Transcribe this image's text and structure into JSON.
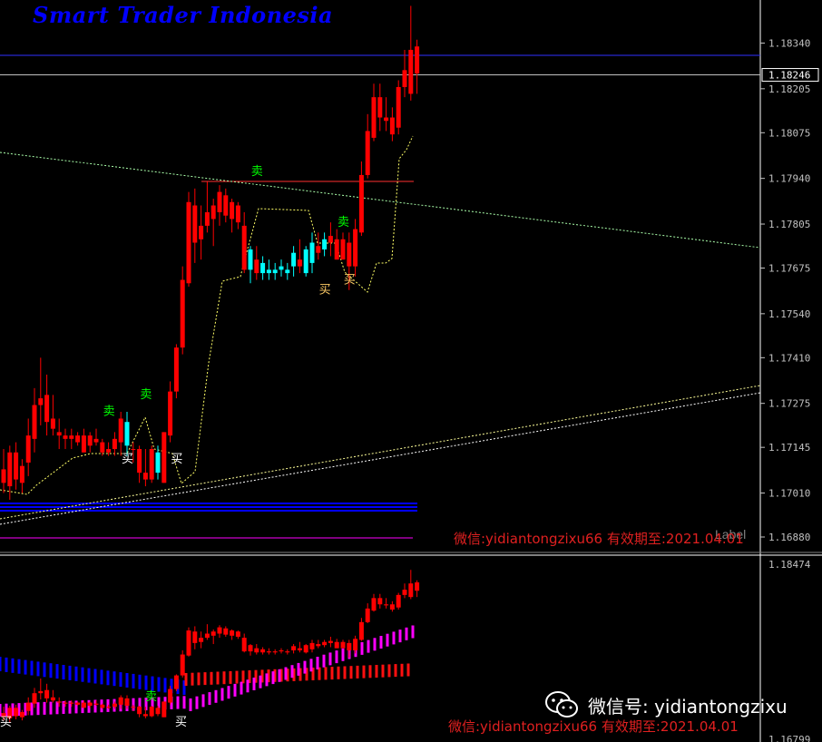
{
  "brand_title": "Smart Trader Indonesia",
  "watermark_top": "微信:yidiantongzixu66 有效期至:2021.04.01",
  "watermark_bottom": "微信:yidiantongzixu66  有效期至:2021.04.01",
  "label_text": "Label",
  "wechat_id": "微信号: yidiantongzixu",
  "colors": {
    "bull": "#00ffff",
    "bear": "#ff0000",
    "blue_band": "#0000ff",
    "magenta_band": "#ff00ff",
    "axis_text": "#c0c0c0",
    "grid_border": "#ffffff"
  },
  "chart_data": [
    {
      "type": "candlestick",
      "pane": "main",
      "ylim": [
        1.168,
        1.1847
      ],
      "y_ticks": [
        "1.18470",
        "1.18340",
        "1.18205",
        "1.18075",
        "1.17940",
        "1.17805",
        "1.17675",
        "1.17540",
        "1.17410",
        "1.17275",
        "1.17145",
        "1.17010",
        "1.16880"
      ],
      "current_price": "1.18246",
      "candles": [
        {
          "o": 1.1708,
          "h": 1.1714,
          "l": 1.1701,
          "c": 1.1704
        },
        {
          "o": 1.1703,
          "h": 1.1715,
          "l": 1.1699,
          "c": 1.1713
        },
        {
          "o": 1.1713,
          "h": 1.1716,
          "l": 1.1702,
          "c": 1.1705
        },
        {
          "o": 1.1704,
          "h": 1.1711,
          "l": 1.1701,
          "c": 1.1709
        },
        {
          "o": 1.171,
          "h": 1.1723,
          "l": 1.1706,
          "c": 1.1718
        },
        {
          "o": 1.1717,
          "h": 1.1732,
          "l": 1.1713,
          "c": 1.1727
        },
        {
          "o": 1.1727,
          "h": 1.1741,
          "l": 1.1721,
          "c": 1.1729
        },
        {
          "o": 1.173,
          "h": 1.1736,
          "l": 1.1718,
          "c": 1.1722
        },
        {
          "o": 1.1723,
          "h": 1.173,
          "l": 1.1718,
          "c": 1.172
        },
        {
          "o": 1.1719,
          "h": 1.1723,
          "l": 1.1714,
          "c": 1.1718
        },
        {
          "o": 1.1718,
          "h": 1.172,
          "l": 1.1714,
          "c": 1.1717
        },
        {
          "o": 1.1718,
          "h": 1.172,
          "l": 1.1714,
          "c": 1.1717
        },
        {
          "o": 1.1718,
          "h": 1.1719,
          "l": 1.1715,
          "c": 1.1716
        },
        {
          "o": 1.1713,
          "h": 1.172,
          "l": 1.1713,
          "c": 1.1718
        },
        {
          "o": 1.1715,
          "h": 1.1719,
          "l": 1.1713,
          "c": 1.1718
        },
        {
          "o": 1.1716,
          "h": 1.172,
          "l": 1.1715,
          "c": 1.1717
        },
        {
          "o": 1.1713,
          "h": 1.1717,
          "l": 1.1712,
          "c": 1.1716
        },
        {
          "o": 1.1713,
          "h": 1.1716,
          "l": 1.1712,
          "c": 1.1714
        },
        {
          "o": 1.1714,
          "h": 1.1719,
          "l": 1.1712,
          "c": 1.1717
        },
        {
          "o": 1.1716,
          "h": 1.1725,
          "l": 1.1712,
          "c": 1.1723
        },
        {
          "o": 1.1722,
          "h": 1.1725,
          "l": 1.1712,
          "c": 1.1715
        },
        {
          "o": 1.1714,
          "h": 1.1716,
          "l": 1.171,
          "c": 1.1714
        },
        {
          "o": 1.1707,
          "h": 1.1715,
          "l": 1.1704,
          "c": 1.1714
        },
        {
          "o": 1.1705,
          "h": 1.1714,
          "l": 1.1703,
          "c": 1.1707
        },
        {
          "o": 1.1705,
          "h": 1.1715,
          "l": 1.1704,
          "c": 1.1714
        },
        {
          "o": 1.1713,
          "h": 1.1715,
          "l": 1.1705,
          "c": 1.1707
        },
        {
          "o": 1.1704,
          "h": 1.1719,
          "l": 1.1704,
          "c": 1.1719
        },
        {
          "o": 1.1718,
          "h": 1.1734,
          "l": 1.1716,
          "c": 1.1731
        },
        {
          "o": 1.1731,
          "h": 1.1745,
          "l": 1.1729,
          "c": 1.1744
        },
        {
          "o": 1.1744,
          "h": 1.1768,
          "l": 1.1742,
          "c": 1.1764
        },
        {
          "o": 1.1763,
          "h": 1.179,
          "l": 1.1762,
          "c": 1.1787
        },
        {
          "o": 1.1786,
          "h": 1.1791,
          "l": 1.1769,
          "c": 1.1775
        },
        {
          "o": 1.1776,
          "h": 1.1786,
          "l": 1.177,
          "c": 1.178
        },
        {
          "o": 1.178,
          "h": 1.1793,
          "l": 1.1778,
          "c": 1.1784
        },
        {
          "o": 1.1782,
          "h": 1.1788,
          "l": 1.1774,
          "c": 1.1786
        },
        {
          "o": 1.1784,
          "h": 1.1792,
          "l": 1.178,
          "c": 1.179
        },
        {
          "o": 1.1789,
          "h": 1.1791,
          "l": 1.1781,
          "c": 1.1783
        },
        {
          "o": 1.1782,
          "h": 1.1788,
          "l": 1.1778,
          "c": 1.1787
        },
        {
          "o": 1.1786,
          "h": 1.1787,
          "l": 1.1779,
          "c": 1.1781
        },
        {
          "o": 1.178,
          "h": 1.1784,
          "l": 1.1766,
          "c": 1.1767
        },
        {
          "o": 1.1767,
          "h": 1.1774,
          "l": 1.1763,
          "c": 1.1773
        },
        {
          "o": 1.177,
          "h": 1.1774,
          "l": 1.1764,
          "c": 1.1766
        },
        {
          "o": 1.1766,
          "h": 1.1771,
          "l": 1.1764,
          "c": 1.1769
        },
        {
          "o": 1.1766,
          "h": 1.177,
          "l": 1.1764,
          "c": 1.1767
        },
        {
          "o": 1.1766,
          "h": 1.1769,
          "l": 1.1764,
          "c": 1.1767
        },
        {
          "o": 1.1767,
          "h": 1.177,
          "l": 1.1765,
          "c": 1.1768
        },
        {
          "o": 1.1766,
          "h": 1.1769,
          "l": 1.1764,
          "c": 1.1767
        },
        {
          "o": 1.1768,
          "h": 1.1774,
          "l": 1.1765,
          "c": 1.1772
        },
        {
          "o": 1.177,
          "h": 1.1776,
          "l": 1.1766,
          "c": 1.1768
        },
        {
          "o": 1.1766,
          "h": 1.1774,
          "l": 1.1765,
          "c": 1.1773
        },
        {
          "o": 1.1769,
          "h": 1.1778,
          "l": 1.1766,
          "c": 1.1775
        },
        {
          "o": 1.1774,
          "h": 1.1778,
          "l": 1.177,
          "c": 1.1772
        },
        {
          "o": 1.1773,
          "h": 1.1778,
          "l": 1.1771,
          "c": 1.1776
        },
        {
          "o": 1.1777,
          "h": 1.1781,
          "l": 1.1771,
          "c": 1.1775
        },
        {
          "o": 1.1776,
          "h": 1.1779,
          "l": 1.177,
          "c": 1.177
        },
        {
          "o": 1.1776,
          "h": 1.1778,
          "l": 1.177,
          "c": 1.177
        },
        {
          "o": 1.1775,
          "h": 1.1778,
          "l": 1.1761,
          "c": 1.1768
        },
        {
          "o": 1.1768,
          "h": 1.1782,
          "l": 1.1765,
          "c": 1.1779
        },
        {
          "o": 1.1778,
          "h": 1.1799,
          "l": 1.1777,
          "c": 1.1795
        },
        {
          "o": 1.1795,
          "h": 1.1813,
          "l": 1.1794,
          "c": 1.1808
        },
        {
          "o": 1.1806,
          "h": 1.1822,
          "l": 1.1805,
          "c": 1.1818
        },
        {
          "o": 1.1818,
          "h": 1.1822,
          "l": 1.1808,
          "c": 1.1812
        },
        {
          "o": 1.1811,
          "h": 1.1818,
          "l": 1.1808,
          "c": 1.1812
        },
        {
          "o": 1.1807,
          "h": 1.1815,
          "l": 1.1805,
          "c": 1.1812
        },
        {
          "o": 1.1809,
          "h": 1.1823,
          "l": 1.1807,
          "c": 1.1821
        },
        {
          "o": 1.1821,
          "h": 1.1832,
          "l": 1.1818,
          "c": 1.1826
        },
        {
          "o": 1.1819,
          "h": 1.1845,
          "l": 1.1817,
          "c": 1.1832
        },
        {
          "o": 1.1833,
          "h": 1.1835,
          "l": 1.1819,
          "c": 1.1825
        }
      ],
      "signals": [
        {
          "text": "卖",
          "i": 17,
          "price": 1.1724,
          "color": "#00ff00"
        },
        {
          "text": "买",
          "i": 20,
          "price": 1.171,
          "color": "#ffffff"
        },
        {
          "text": "卖",
          "i": 23,
          "price": 1.1729,
          "color": "#00ff00"
        },
        {
          "text": "买",
          "i": 28,
          "price": 1.171,
          "color": "#ffffff"
        },
        {
          "text": "卖",
          "i": 41,
          "price": 1.1795,
          "color": "#00ff00"
        },
        {
          "text": "买",
          "i": 52,
          "price": 1.176,
          "color": "#ffcc66"
        },
        {
          "text": "卖",
          "i": 55,
          "price": 1.178,
          "color": "#00ff00"
        },
        {
          "text": "买",
          "i": 56,
          "price": 1.1763,
          "color": "#ffcc66"
        }
      ]
    },
    {
      "type": "candlestick",
      "pane": "sub",
      "ylim": [
        1.16799,
        1.18474
      ],
      "y_ticks": [
        "1.18474",
        "1.16799"
      ],
      "bands": [
        "blue channel",
        "red channel",
        "magenta channel"
      ]
    }
  ]
}
